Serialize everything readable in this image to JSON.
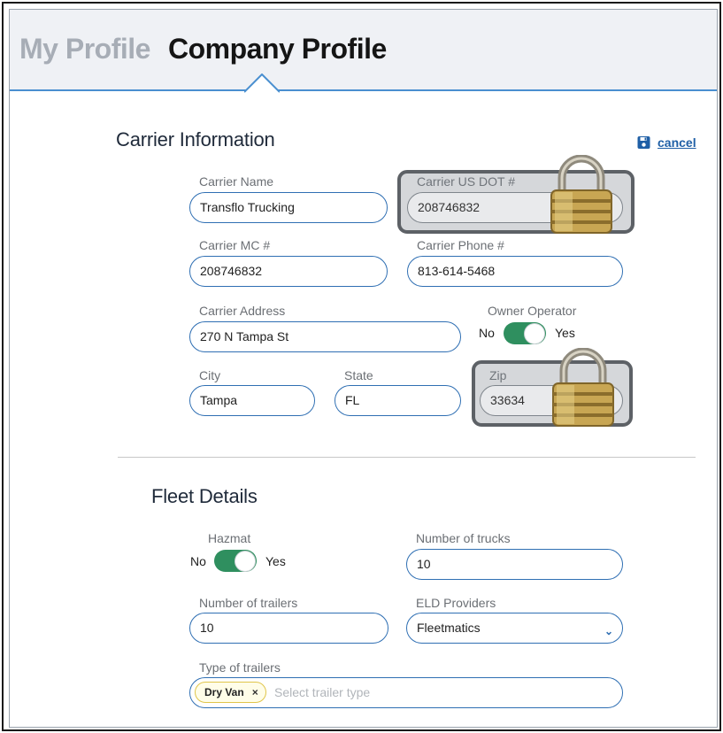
{
  "tabs": {
    "my_profile": "My Profile",
    "company_profile": "Company Profile"
  },
  "carrier": {
    "title": "Carrier Information",
    "cancel": "cancel",
    "name": {
      "label": "Carrier Name",
      "value": "Transflo Trucking"
    },
    "dot": {
      "label": "Carrier US DOT #",
      "value": "208746832",
      "locked": true
    },
    "mc": {
      "label": "Carrier MC #",
      "value": "208746832"
    },
    "phone": {
      "label": "Carrier Phone #",
      "value": "813-614-5468"
    },
    "address": {
      "label": "Carrier Address",
      "value": "270 N Tampa St"
    },
    "owner_operator": {
      "label": "Owner Operator",
      "no": "No",
      "yes": "Yes",
      "on": true
    },
    "city": {
      "label": "City",
      "value": "Tampa"
    },
    "state": {
      "label": "State",
      "value": "FL"
    },
    "zip": {
      "label": "Zip",
      "value": "33634",
      "locked": true
    }
  },
  "fleet": {
    "title": "Fleet Details",
    "hazmat": {
      "label": "Hazmat",
      "no": "No",
      "yes": "Yes",
      "on": true
    },
    "trucks": {
      "label": "Number of trucks",
      "value": "10"
    },
    "trailers": {
      "label": "Number of trailers",
      "value": "10"
    },
    "eld": {
      "label": "ELD Providers",
      "value": "Fleetmatics"
    },
    "trailer_types": {
      "label": "Type of trailers",
      "chips": [
        "Dry Van"
      ],
      "placeholder": "Select trailer type"
    }
  },
  "colors": {
    "accent": "#2f6fb3",
    "toggle_on": "#2f8f5f",
    "header_bg": "#eff1f5"
  },
  "icons": {
    "lock": "padlock-icon",
    "save": "floppy-disk-icon",
    "chevron": "chevron-down-icon",
    "remove": "close-icon"
  }
}
